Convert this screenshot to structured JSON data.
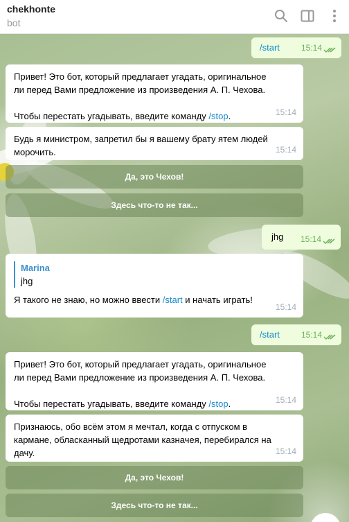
{
  "header": {
    "title": "chekhonte",
    "subtitle": "bot"
  },
  "messages": [
    {
      "id": "m1",
      "direction": "out",
      "text": "/start",
      "time": "15:14"
    },
    {
      "id": "m2",
      "direction": "in",
      "line1": "Привет! Это бот, который предлагает угадать, оригинальное",
      "line2": "ли перед Вами предложение из произведения А. П. Чехова.",
      "line3_prefix": " Чтобы перестать угадывать, введите команду ",
      "line3_link": "/stop",
      "line3_suffix": ".",
      "time": "15:14"
    },
    {
      "id": "m3",
      "direction": "in",
      "line1": "Будь я министром, запретил бы я вашему брату ятем людей",
      "line2": "морочить.",
      "time": "15:14"
    },
    {
      "id": "m4",
      "direction": "out",
      "text": "jhg",
      "time": "15:14"
    },
    {
      "id": "m5",
      "direction": "in",
      "reply_author": "Marina",
      "reply_text": "jhg",
      "prefix": "Я такого не знаю, но можно ввести ",
      "link": "/start",
      "suffix": " и начать играть!",
      "time": "15:14"
    },
    {
      "id": "m6",
      "direction": "out",
      "text": "/start",
      "time": "15:14"
    },
    {
      "id": "m7",
      "direction": "in",
      "line1": "Привет! Это бот, который предлагает угадать, оригинальное",
      "line2": "ли перед Вами предложение из произведения А. П. Чехова.",
      "line3_prefix": " Чтобы перестать угадывать, введите команду ",
      "line3_link": "/stop",
      "line3_suffix": ".",
      "time": "15:14"
    },
    {
      "id": "m8",
      "direction": "in",
      "line1": "Признаюсь, обо всём этом я мечтал, когда с отпуском в",
      "line2": "кармане, обласканный щедротами казначея, перебирался на",
      "line3": "дачу.",
      "time": "15:14"
    }
  ],
  "keyboard1": {
    "btn1": "Да, это Чехов!",
    "btn2": "Здесь что-то не так..."
  },
  "keyboard2": {
    "btn1": "Да, это Чехов!",
    "btn2": "Здесь что-то не так..."
  },
  "icons": {
    "search": "search-icon",
    "sidebar": "sidebar-toggle-icon",
    "more": "more-vertical-icon",
    "read": "double-check-icon"
  },
  "colors": {
    "link": "#168acd",
    "outgoing_bubble": "#effdde",
    "incoming_bubble": "#ffffff",
    "check": "#6cb25a"
  }
}
